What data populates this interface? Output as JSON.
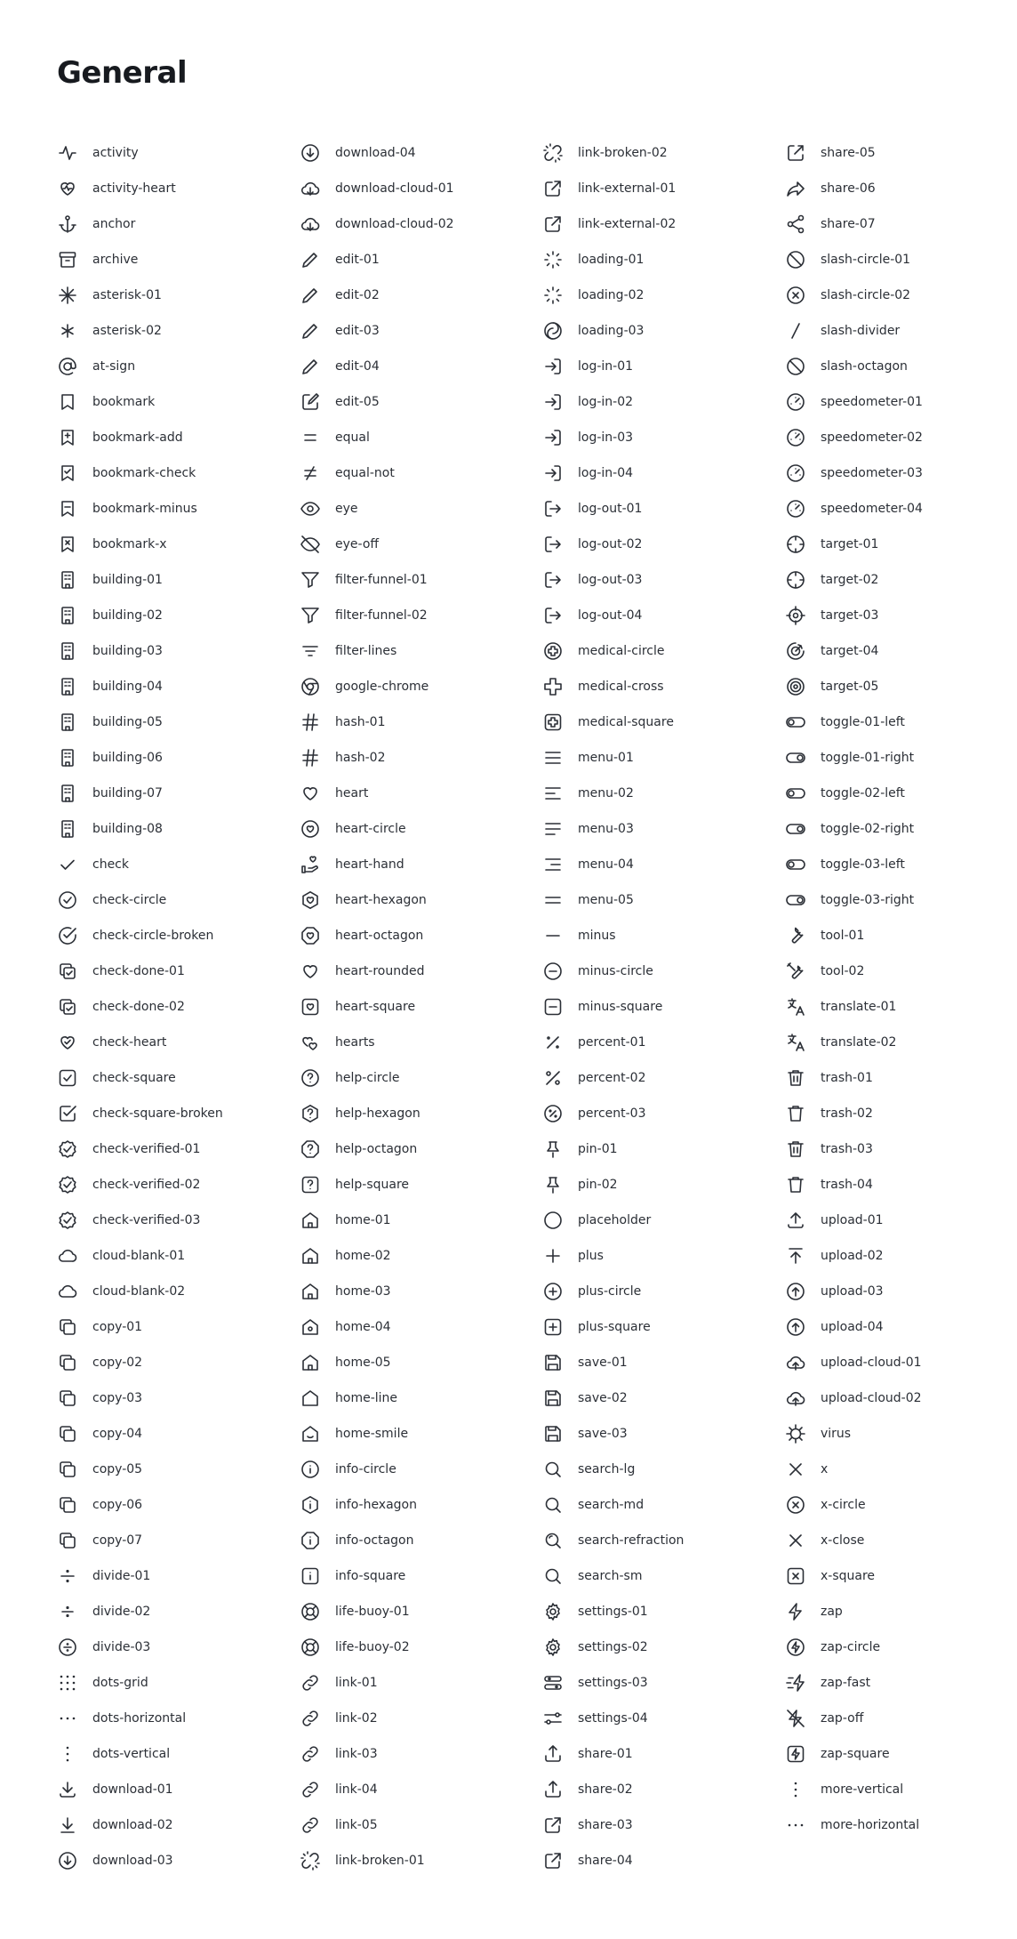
{
  "title": "General",
  "columns": [
    [
      {
        "label": "activity",
        "icon": "activity-icon"
      },
      {
        "label": "activity-heart",
        "icon": "activity-heart-icon"
      },
      {
        "label": "anchor",
        "icon": "anchor-icon"
      },
      {
        "label": "archive",
        "icon": "archive-icon"
      },
      {
        "label": "asterisk-01",
        "icon": "asterisk-01-icon"
      },
      {
        "label": "asterisk-02",
        "icon": "asterisk-02-icon"
      },
      {
        "label": "at-sign",
        "icon": "at-sign-icon"
      },
      {
        "label": "bookmark",
        "icon": "bookmark-icon"
      },
      {
        "label": "bookmark-add",
        "icon": "bookmark-add-icon"
      },
      {
        "label": "bookmark-check",
        "icon": "bookmark-check-icon"
      },
      {
        "label": "bookmark-minus",
        "icon": "bookmark-minus-icon"
      },
      {
        "label": "bookmark-x",
        "icon": "bookmark-x-icon"
      },
      {
        "label": "building-01",
        "icon": "building-01-icon"
      },
      {
        "label": "building-02",
        "icon": "building-02-icon"
      },
      {
        "label": "building-03",
        "icon": "building-03-icon"
      },
      {
        "label": "building-04",
        "icon": "building-04-icon"
      },
      {
        "label": "building-05",
        "icon": "building-05-icon"
      },
      {
        "label": "building-06",
        "icon": "building-06-icon"
      },
      {
        "label": "building-07",
        "icon": "building-07-icon"
      },
      {
        "label": "building-08",
        "icon": "building-08-icon"
      },
      {
        "label": "check",
        "icon": "check-icon"
      },
      {
        "label": "check-circle",
        "icon": "check-circle-icon"
      },
      {
        "label": "check-circle-broken",
        "icon": "check-circle-broken-icon"
      },
      {
        "label": "check-done-01",
        "icon": "check-done-01-icon"
      },
      {
        "label": "check-done-02",
        "icon": "check-done-02-icon"
      },
      {
        "label": "check-heart",
        "icon": "check-heart-icon"
      },
      {
        "label": "check-square",
        "icon": "check-square-icon"
      },
      {
        "label": "check-square-broken",
        "icon": "check-square-broken-icon"
      },
      {
        "label": "check-verified-01",
        "icon": "check-verified-01-icon"
      },
      {
        "label": "check-verified-02",
        "icon": "check-verified-02-icon"
      },
      {
        "label": "check-verified-03",
        "icon": "check-verified-03-icon"
      },
      {
        "label": "cloud-blank-01",
        "icon": "cloud-blank-01-icon"
      },
      {
        "label": "cloud-blank-02",
        "icon": "cloud-blank-02-icon"
      },
      {
        "label": "copy-01",
        "icon": "copy-01-icon"
      },
      {
        "label": "copy-02",
        "icon": "copy-02-icon"
      },
      {
        "label": "copy-03",
        "icon": "copy-03-icon"
      },
      {
        "label": "copy-04",
        "icon": "copy-04-icon"
      },
      {
        "label": "copy-05",
        "icon": "copy-05-icon"
      },
      {
        "label": "copy-06",
        "icon": "copy-06-icon"
      },
      {
        "label": "copy-07",
        "icon": "copy-07-icon"
      },
      {
        "label": "divide-01",
        "icon": "divide-01-icon"
      },
      {
        "label": "divide-02",
        "icon": "divide-02-icon"
      },
      {
        "label": "divide-03",
        "icon": "divide-03-icon"
      },
      {
        "label": "dots-grid",
        "icon": "dots-grid-icon"
      },
      {
        "label": "dots-horizontal",
        "icon": "dots-horizontal-icon"
      },
      {
        "label": "dots-vertical",
        "icon": "dots-vertical-icon"
      },
      {
        "label": "download-01",
        "icon": "download-01-icon"
      },
      {
        "label": "download-02",
        "icon": "download-02-icon"
      },
      {
        "label": "download-03",
        "icon": "download-03-icon"
      }
    ],
    [
      {
        "label": "download-04",
        "icon": "download-04-icon"
      },
      {
        "label": "download-cloud-01",
        "icon": "download-cloud-01-icon"
      },
      {
        "label": "download-cloud-02",
        "icon": "download-cloud-02-icon"
      },
      {
        "label": "edit-01",
        "icon": "edit-01-icon"
      },
      {
        "label": "edit-02",
        "icon": "edit-02-icon"
      },
      {
        "label": "edit-03",
        "icon": "edit-03-icon"
      },
      {
        "label": "edit-04",
        "icon": "edit-04-icon"
      },
      {
        "label": "edit-05",
        "icon": "edit-05-icon"
      },
      {
        "label": "equal",
        "icon": "equal-icon"
      },
      {
        "label": "equal-not",
        "icon": "equal-not-icon"
      },
      {
        "label": "eye",
        "icon": "eye-icon"
      },
      {
        "label": "eye-off",
        "icon": "eye-off-icon"
      },
      {
        "label": "filter-funnel-01",
        "icon": "filter-funnel-01-icon"
      },
      {
        "label": "filter-funnel-02",
        "icon": "filter-funnel-02-icon"
      },
      {
        "label": "filter-lines",
        "icon": "filter-lines-icon"
      },
      {
        "label": "google-chrome",
        "icon": "google-chrome-icon"
      },
      {
        "label": "hash-01",
        "icon": "hash-01-icon"
      },
      {
        "label": "hash-02",
        "icon": "hash-02-icon"
      },
      {
        "label": "heart",
        "icon": "heart-icon"
      },
      {
        "label": "heart-circle",
        "icon": "heart-circle-icon"
      },
      {
        "label": "heart-hand",
        "icon": "heart-hand-icon"
      },
      {
        "label": "heart-hexagon",
        "icon": "heart-hexagon-icon"
      },
      {
        "label": "heart-octagon",
        "icon": "heart-octagon-icon"
      },
      {
        "label": "heart-rounded",
        "icon": "heart-rounded-icon"
      },
      {
        "label": "heart-square",
        "icon": "heart-square-icon"
      },
      {
        "label": "hearts",
        "icon": "hearts-icon"
      },
      {
        "label": "help-circle",
        "icon": "help-circle-icon"
      },
      {
        "label": "help-hexagon",
        "icon": "help-hexagon-icon"
      },
      {
        "label": "help-octagon",
        "icon": "help-octagon-icon"
      },
      {
        "label": "help-square",
        "icon": "help-square-icon"
      },
      {
        "label": "home-01",
        "icon": "home-01-icon"
      },
      {
        "label": "home-02",
        "icon": "home-02-icon"
      },
      {
        "label": "home-03",
        "icon": "home-03-icon"
      },
      {
        "label": "home-04",
        "icon": "home-04-icon"
      },
      {
        "label": "home-05",
        "icon": "home-05-icon"
      },
      {
        "label": "home-line",
        "icon": "home-line-icon"
      },
      {
        "label": "home-smile",
        "icon": "home-smile-icon"
      },
      {
        "label": "info-circle",
        "icon": "info-circle-icon"
      },
      {
        "label": "info-hexagon",
        "icon": "info-hexagon-icon"
      },
      {
        "label": "info-octagon",
        "icon": "info-octagon-icon"
      },
      {
        "label": "info-square",
        "icon": "info-square-icon"
      },
      {
        "label": "life-buoy-01",
        "icon": "life-buoy-01-icon"
      },
      {
        "label": "life-buoy-02",
        "icon": "life-buoy-02-icon"
      },
      {
        "label": "link-01",
        "icon": "link-01-icon"
      },
      {
        "label": "link-02",
        "icon": "link-02-icon"
      },
      {
        "label": "link-03",
        "icon": "link-03-icon"
      },
      {
        "label": "link-04",
        "icon": "link-04-icon"
      },
      {
        "label": "link-05",
        "icon": "link-05-icon"
      },
      {
        "label": "link-broken-01",
        "icon": "link-broken-01-icon"
      }
    ],
    [
      {
        "label": "link-broken-02",
        "icon": "link-broken-02-icon"
      },
      {
        "label": "link-external-01",
        "icon": "link-external-01-icon"
      },
      {
        "label": "link-external-02",
        "icon": "link-external-02-icon"
      },
      {
        "label": "loading-01",
        "icon": "loading-01-icon"
      },
      {
        "label": "loading-02",
        "icon": "loading-02-icon"
      },
      {
        "label": "loading-03",
        "icon": "loading-03-icon"
      },
      {
        "label": "log-in-01",
        "icon": "log-in-01-icon"
      },
      {
        "label": "log-in-02",
        "icon": "log-in-02-icon"
      },
      {
        "label": "log-in-03",
        "icon": "log-in-03-icon"
      },
      {
        "label": "log-in-04",
        "icon": "log-in-04-icon"
      },
      {
        "label": "log-out-01",
        "icon": "log-out-01-icon"
      },
      {
        "label": "log-out-02",
        "icon": "log-out-02-icon"
      },
      {
        "label": "log-out-03",
        "icon": "log-out-03-icon"
      },
      {
        "label": "log-out-04",
        "icon": "log-out-04-icon"
      },
      {
        "label": "medical-circle",
        "icon": "medical-circle-icon"
      },
      {
        "label": "medical-cross",
        "icon": "medical-cross-icon"
      },
      {
        "label": "medical-square",
        "icon": "medical-square-icon"
      },
      {
        "label": "menu-01",
        "icon": "menu-01-icon"
      },
      {
        "label": "menu-02",
        "icon": "menu-02-icon"
      },
      {
        "label": "menu-03",
        "icon": "menu-03-icon"
      },
      {
        "label": "menu-04",
        "icon": "menu-04-icon"
      },
      {
        "label": "menu-05",
        "icon": "menu-05-icon"
      },
      {
        "label": "minus",
        "icon": "minus-icon"
      },
      {
        "label": "minus-circle",
        "icon": "minus-circle-icon"
      },
      {
        "label": "minus-square",
        "icon": "minus-square-icon"
      },
      {
        "label": "percent-01",
        "icon": "percent-01-icon"
      },
      {
        "label": "percent-02",
        "icon": "percent-02-icon"
      },
      {
        "label": "percent-03",
        "icon": "percent-03-icon"
      },
      {
        "label": "pin-01",
        "icon": "pin-01-icon"
      },
      {
        "label": "pin-02",
        "icon": "pin-02-icon"
      },
      {
        "label": "placeholder",
        "icon": "placeholder-icon"
      },
      {
        "label": "plus",
        "icon": "plus-icon"
      },
      {
        "label": "plus-circle",
        "icon": "plus-circle-icon"
      },
      {
        "label": "plus-square",
        "icon": "plus-square-icon"
      },
      {
        "label": "save-01",
        "icon": "save-01-icon"
      },
      {
        "label": "save-02",
        "icon": "save-02-icon"
      },
      {
        "label": "save-03",
        "icon": "save-03-icon"
      },
      {
        "label": "search-lg",
        "icon": "search-lg-icon"
      },
      {
        "label": "search-md",
        "icon": "search-md-icon"
      },
      {
        "label": "search-refraction",
        "icon": "search-refraction-icon"
      },
      {
        "label": "search-sm",
        "icon": "search-sm-icon"
      },
      {
        "label": "settings-01",
        "icon": "settings-01-icon"
      },
      {
        "label": "settings-02",
        "icon": "settings-02-icon"
      },
      {
        "label": "settings-03",
        "icon": "settings-03-icon"
      },
      {
        "label": "settings-04",
        "icon": "settings-04-icon"
      },
      {
        "label": "share-01",
        "icon": "share-01-icon"
      },
      {
        "label": "share-02",
        "icon": "share-02-icon"
      },
      {
        "label": "share-03",
        "icon": "share-03-icon"
      },
      {
        "label": "share-04",
        "icon": "share-04-icon"
      }
    ],
    [
      {
        "label": "share-05",
        "icon": "share-05-icon"
      },
      {
        "label": "share-06",
        "icon": "share-06-icon"
      },
      {
        "label": "share-07",
        "icon": "share-07-icon"
      },
      {
        "label": "slash-circle-01",
        "icon": "slash-circle-01-icon"
      },
      {
        "label": "slash-circle-02",
        "icon": "slash-circle-02-icon"
      },
      {
        "label": "slash-divider",
        "icon": "slash-divider-icon"
      },
      {
        "label": "slash-octagon",
        "icon": "slash-octagon-icon"
      },
      {
        "label": "speedometer-01",
        "icon": "speedometer-01-icon"
      },
      {
        "label": "speedometer-02",
        "icon": "speedometer-02-icon"
      },
      {
        "label": "speedometer-03",
        "icon": "speedometer-03-icon"
      },
      {
        "label": "speedometer-04",
        "icon": "speedometer-04-icon"
      },
      {
        "label": "target-01",
        "icon": "target-01-icon"
      },
      {
        "label": "target-02",
        "icon": "target-02-icon"
      },
      {
        "label": "target-03",
        "icon": "target-03-icon"
      },
      {
        "label": "target-04",
        "icon": "target-04-icon"
      },
      {
        "label": "target-05",
        "icon": "target-05-icon"
      },
      {
        "label": "toggle-01-left",
        "icon": "toggle-01-left-icon"
      },
      {
        "label": "toggle-01-right",
        "icon": "toggle-01-right-icon"
      },
      {
        "label": "toggle-02-left",
        "icon": "toggle-02-left-icon"
      },
      {
        "label": "toggle-02-right",
        "icon": "toggle-02-right-icon"
      },
      {
        "label": "toggle-03-left",
        "icon": "toggle-03-left-icon"
      },
      {
        "label": "toggle-03-right",
        "icon": "toggle-03-right-icon"
      },
      {
        "label": "tool-01",
        "icon": "tool-01-icon"
      },
      {
        "label": "tool-02",
        "icon": "tool-02-icon"
      },
      {
        "label": "translate-01",
        "icon": "translate-01-icon"
      },
      {
        "label": "translate-02",
        "icon": "translate-02-icon"
      },
      {
        "label": "trash-01",
        "icon": "trash-01-icon"
      },
      {
        "label": "trash-02",
        "icon": "trash-02-icon"
      },
      {
        "label": "trash-03",
        "icon": "trash-03-icon"
      },
      {
        "label": "trash-04",
        "icon": "trash-04-icon"
      },
      {
        "label": "upload-01",
        "icon": "upload-01-icon"
      },
      {
        "label": "upload-02",
        "icon": "upload-02-icon"
      },
      {
        "label": "upload-03",
        "icon": "upload-03-icon"
      },
      {
        "label": "upload-04",
        "icon": "upload-04-icon"
      },
      {
        "label": "upload-cloud-01",
        "icon": "upload-cloud-01-icon"
      },
      {
        "label": "upload-cloud-02",
        "icon": "upload-cloud-02-icon"
      },
      {
        "label": "virus",
        "icon": "virus-icon"
      },
      {
        "label": "x",
        "icon": "x-icon"
      },
      {
        "label": "x-circle",
        "icon": "x-circle-icon"
      },
      {
        "label": "x-close",
        "icon": "x-close-icon"
      },
      {
        "label": "x-square",
        "icon": "x-square-icon"
      },
      {
        "label": "zap",
        "icon": "zap-icon"
      },
      {
        "label": "zap-circle",
        "icon": "zap-circle-icon"
      },
      {
        "label": "zap-fast",
        "icon": "zap-fast-icon"
      },
      {
        "label": "zap-off",
        "icon": "zap-off-icon"
      },
      {
        "label": "zap-square",
        "icon": "zap-square-icon"
      },
      {
        "label": "more-vertical",
        "icon": "more-vertical-icon"
      },
      {
        "label": "more-horizontal",
        "icon": "more-horizontal-icon"
      }
    ]
  ]
}
